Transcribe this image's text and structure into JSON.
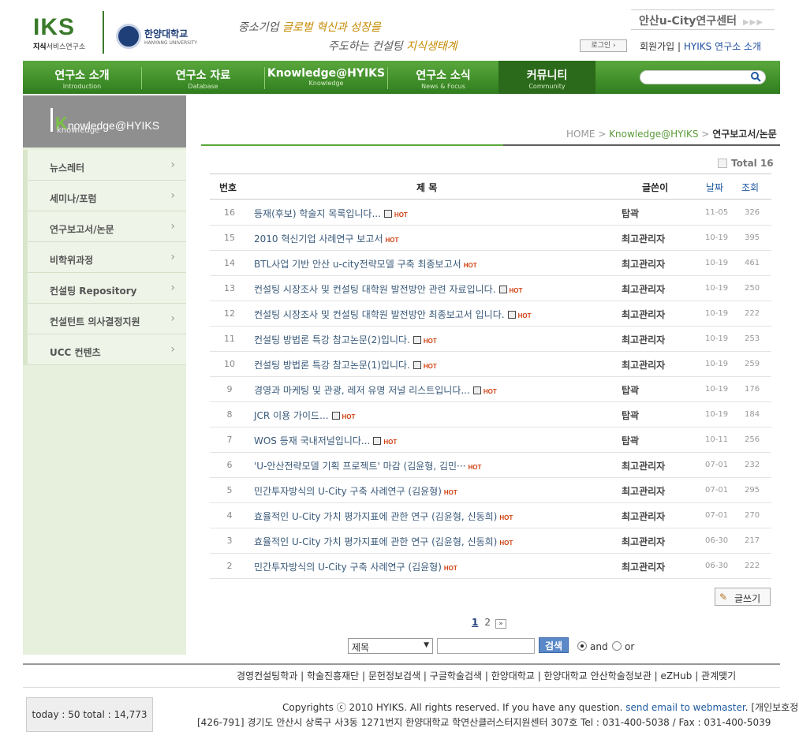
{
  "header": {
    "logo_iks": "IKS",
    "logo_sub_bold": "지식",
    "logo_sub_rest": "서비스연구소",
    "university_name": "한양대학교",
    "university_eng": "HANYANG UNIVERSITY",
    "slogan_line1_a": "중소기업 ",
    "slogan_line1_b": "글로벌 혁신과 성장을",
    "slogan_line2_a": "주도하는 컨설팅 ",
    "slogan_line2_b": "지식생태계",
    "center_title": "안산u-City연구센터",
    "center_arrows": "▶▶▶",
    "login_label": "로그인 ›",
    "join_label": "회원가입",
    "about_label": "HYIKS 연구소 소개"
  },
  "nav": [
    {
      "ko": "연구소 소개",
      "en": "Introduction"
    },
    {
      "ko": "연구소 자료",
      "en": "Database"
    },
    {
      "ko": "Knowledge@HYIKS",
      "en": "Knowledge"
    },
    {
      "ko": "연구소 소식",
      "en": "News & Focus"
    },
    {
      "ko": "커뮤니티",
      "en": "Community"
    }
  ],
  "sidebar": {
    "title_k": "K",
    "title_rest": "nowledge@HYIKS",
    "subtitle": "knowledge",
    "items": [
      {
        "label": "뉴스레터"
      },
      {
        "label": "세미나/포럼"
      },
      {
        "label": "연구보고서/논문"
      },
      {
        "label": "비학위과정"
      },
      {
        "label": "컨설팅 Repository"
      },
      {
        "label": "컨설턴트 의사결정지원"
      },
      {
        "label": "UCC 컨텐츠"
      }
    ],
    "chevron": "›"
  },
  "breadcrumb": {
    "home": "HOME",
    "sep": ">",
    "section": "Knowledge@HYIKS",
    "current": "연구보고서/논문"
  },
  "board": {
    "total_label": "Total 16",
    "columns": {
      "no": "번호",
      "title": "제 목",
      "author": "글쓴이",
      "date": "날짜",
      "views": "조회"
    },
    "hot_label": "HOT",
    "rows": [
      {
        "no": "16",
        "title": "등재(후보) 학술지 목록입니다...",
        "file": true,
        "author": "탑곽",
        "date": "11-05",
        "views": "326"
      },
      {
        "no": "15",
        "title": "2010 혁신기업 사례연구 보고서",
        "file": false,
        "author": "최고관리자",
        "date": "10-19",
        "views": "395"
      },
      {
        "no": "14",
        "title": "BTL사업 기반 안산 u-city전략모델 구축 최종보고서",
        "file": false,
        "author": "최고관리자",
        "date": "10-19",
        "views": "461"
      },
      {
        "no": "13",
        "title": "컨설팅 시장조사 및 컨설팅 대학원 발전방안 관련 자료입니다.",
        "file": true,
        "author": "최고관리자",
        "date": "10-19",
        "views": "250"
      },
      {
        "no": "12",
        "title": "컨설팅 시장조사 및 컨설팅 대학원 발전방안 최종보고서 입니다.",
        "file": true,
        "author": "최고관리자",
        "date": "10-19",
        "views": "222"
      },
      {
        "no": "11",
        "title": "컨설팅 방법론 특강 참고논문(2)입니다.",
        "file": true,
        "author": "최고관리자",
        "date": "10-19",
        "views": "253"
      },
      {
        "no": "10",
        "title": "컨설팅 방법론 특강 참고논문(1)입니다.",
        "file": true,
        "author": "최고관리자",
        "date": "10-19",
        "views": "259"
      },
      {
        "no": "9",
        "title": "경영과 마케팅 및 관광, 레저 유명 저널 리스트입니다...",
        "file": true,
        "author": "탑곽",
        "date": "10-19",
        "views": "176"
      },
      {
        "no": "8",
        "title": "JCR 이용 가이드...",
        "file": true,
        "author": "탑곽",
        "date": "10-19",
        "views": "184"
      },
      {
        "no": "7",
        "title": "WOS 등재 국내저널입니다...",
        "file": true,
        "author": "탑곽",
        "date": "10-11",
        "views": "256"
      },
      {
        "no": "6",
        "title": "'U-안산전략모델 기획 프로젝트' 마감 (김윤형, 김민···",
        "file": false,
        "author": "최고관리자",
        "date": "07-01",
        "views": "232"
      },
      {
        "no": "5",
        "title": "민간투자방식의 U-City 구축 사례연구 (김윤형)",
        "file": false,
        "author": "최고관리자",
        "date": "07-01",
        "views": "295"
      },
      {
        "no": "4",
        "title": "효율적인 U-City 가치 평가지표에 관한 연구 (김윤형, 신동희)",
        "file": false,
        "author": "최고관리자",
        "date": "07-01",
        "views": "270"
      },
      {
        "no": "3",
        "title": "효율적인 U-City 가치 평가지표에 관한 연구 (김윤형, 신동희)",
        "file": false,
        "author": "최고관리자",
        "date": "06-30",
        "views": "217"
      },
      {
        "no": "2",
        "title": "민간투자방식의 U-City 구축 사례연구 (김윤형)",
        "file": false,
        "author": "최고관리자",
        "date": "06-30",
        "views": "222"
      }
    ],
    "write_label": "글쓰기",
    "pages": [
      "1",
      "2"
    ],
    "page_next": "»",
    "search": {
      "field_selected": "제목",
      "keyword_value": "",
      "button_label": "검색",
      "radio_and": "and",
      "radio_or": "or"
    }
  },
  "footer": {
    "links": "경영컨설팅학과 | 학술진흥재단 | 문헌정보검색 | 구글학술검색 | 한양대학교 | 한양대학교 안산학술정보관 | eZHub | 관계맺기",
    "counter": "today : 50 total : 14,773",
    "copyright_a": "Copyrights ⓒ 2010 HYIKS. All rights reserved. If you have any question. ",
    "copyright_link": "send email to webmaster",
    "copyright_b": ". [개인보호정책]",
    "address": "[426-791] 경기도 안산시 상록구 사3동 1271번지 한양대학교 학연산클러스터지원센터 307호 Tel : 031-400-5038 / Fax : 031-400-5039"
  }
}
